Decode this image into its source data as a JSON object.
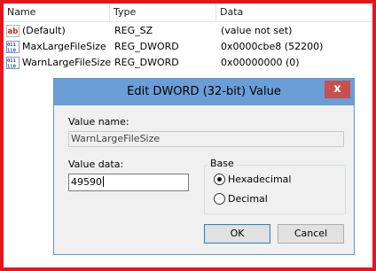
{
  "columns": {
    "name": "Name",
    "type": "Type",
    "data": "Data"
  },
  "rows": [
    {
      "icon": "string-value-icon",
      "name": "(Default)",
      "type": "REG_SZ",
      "data": "(value not set)"
    },
    {
      "icon": "dword-value-icon",
      "name": "MaxLargeFileSize",
      "type": "REG_DWORD",
      "data": "0x0000cbe8 (52200)"
    },
    {
      "icon": "dword-value-icon",
      "name": "WarnLargeFileSize",
      "type": "REG_DWORD",
      "data": "0x00000000 (0)"
    }
  ],
  "dialog": {
    "title": "Edit DWORD (32-bit) Value",
    "close_glyph": "x",
    "value_name_label": "Value name:",
    "value_name": "WarnLargeFileSize",
    "value_data_label": "Value data:",
    "value_data": "49590",
    "base_label": "Base",
    "base_options": [
      "Hexadecimal",
      "Decimal"
    ],
    "base_selected": "Hexadecimal",
    "ok_label": "OK",
    "cancel_label": "Cancel"
  },
  "colors": {
    "frame_border": "#e8141b",
    "titlebar": "#6a9ed7",
    "close_button": "#c75050"
  }
}
